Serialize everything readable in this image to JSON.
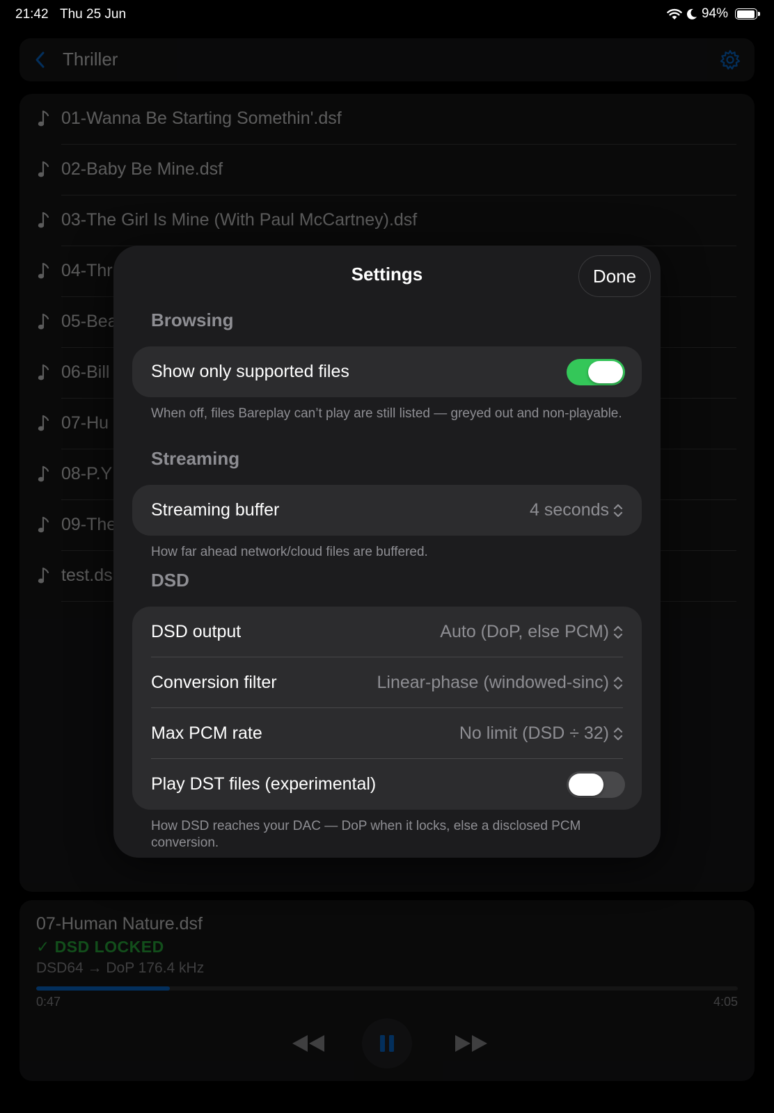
{
  "status_bar": {
    "time": "21:42",
    "date": "Thu 25 Jun",
    "battery": "94%",
    "battery_level": 0.94
  },
  "nav": {
    "title": "Thriller",
    "back_icon": "chevron-left-icon",
    "settings_icon": "gear-icon",
    "accent": "#0a84ff"
  },
  "tracks": [
    "01-Wanna Be Starting Somethin'.dsf",
    "02-Baby Be Mine.dsf",
    "03-The Girl Is Mine (With Paul McCartney).dsf",
    "04-Thr",
    "05-Bea",
    "06-Bill",
    "07-Hu",
    "08-P.Y",
    "09-The",
    "test.ds"
  ],
  "settings": {
    "title": "Settings",
    "done_label": "Done",
    "browsing": {
      "header": "Browsing",
      "show_supported_label": "Show only supported files",
      "show_supported_on": true,
      "note": "When off, files Bareplay can’t play are still listed — greyed out and non-playable."
    },
    "streaming": {
      "header": "Streaming",
      "buffer_label": "Streaming buffer",
      "buffer_value": "4 seconds",
      "note": "How far ahead network/cloud files are buffered."
    },
    "dsd": {
      "header": "DSD",
      "output_label": "DSD output",
      "output_value": "Auto (DoP, else PCM)",
      "filter_label": "Conversion filter",
      "filter_value": "Linear-phase (windowed-sinc)",
      "max_rate_label": "Max PCM rate",
      "max_rate_value": "No limit (DSD ÷ 32)",
      "dst_label": "Play DST files (experimental)",
      "dst_on": false,
      "note": "How DSD reaches your DAC — DoP when it locks, else a disclosed PCM conversion."
    }
  },
  "now_playing": {
    "title": "07-Human Nature.dsf",
    "status": "✓ DSD LOCKED",
    "status_color": "#32d74b",
    "format": "DSD64 → DoP 176.4 kHz",
    "elapsed": "0:47",
    "total": "4:05",
    "progress": 0.19,
    "controls": [
      "rewind-icon",
      "pause-icon",
      "fast-forward-icon"
    ]
  }
}
